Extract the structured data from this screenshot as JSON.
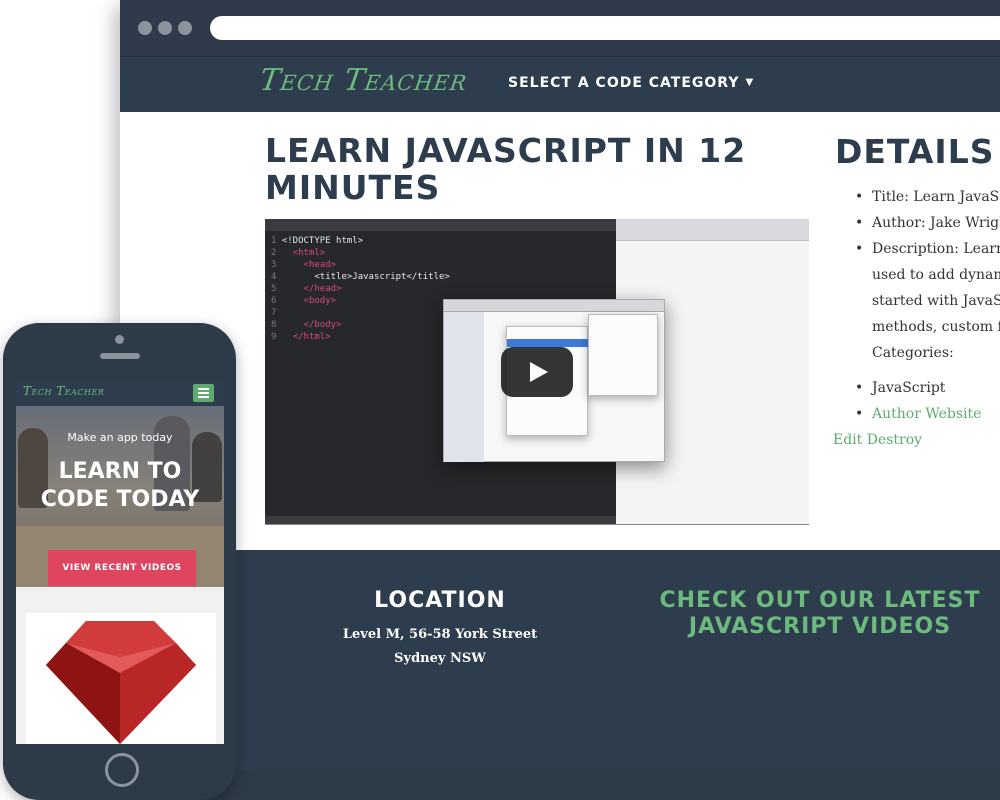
{
  "desktop": {
    "site": {
      "logo": "Tech Teacher",
      "nav_category": "SELECT A CODE CATEGORY"
    },
    "main": {
      "title": "LEARN JAVASCRIPT IN 12 MINUTES",
      "video_code_lines": [
        "<!DOCTYPE html>",
        "<html>",
        "<head>",
        "<title>Javascript</title>",
        "</head>",
        "<body>",
        "",
        "</body>",
        "</html>"
      ]
    },
    "details": {
      "title": "DETAILS",
      "title_item": "Title: Learn JavaScr",
      "author_item": "Author: Jake Wright",
      "description_line1": "Description: Learn t",
      "description_line2": "used to add dynami",
      "description_line3": "started with JavaSc",
      "description_line4": "methods, custom fu",
      "categories_label": "Categories:",
      "category_item": "JavaScript",
      "author_website": "Author Website",
      "edit_destroy": "Edit Destroy"
    },
    "footer": {
      "location_title": "LOCATION",
      "address_line1": "Level M, 56-58 York Street",
      "address_line2": "Sydney NSW",
      "videos_title_line1": "CHECK OUT OUR LATEST",
      "videos_title_line2": "JAVASCRIPT VIDEOS"
    }
  },
  "mobile": {
    "logo": "Tech Teacher",
    "hero_subtitle": "Make an app today",
    "hero_headline_line1": "LEARN TO",
    "hero_headline_line2": "CODE TODAY",
    "hero_button": "VIEW RECENT VIDEOS"
  },
  "icons": {
    "caret": "chevron-down-icon",
    "play": "play-icon",
    "menu": "hamburger-menu-icon",
    "card_image": "ruby-gem-icon"
  },
  "colors": {
    "navy": "#2e3d4d",
    "green_accent": "#6cba7d",
    "link_green": "#5eaa6f",
    "cta_red": "#e04560"
  }
}
